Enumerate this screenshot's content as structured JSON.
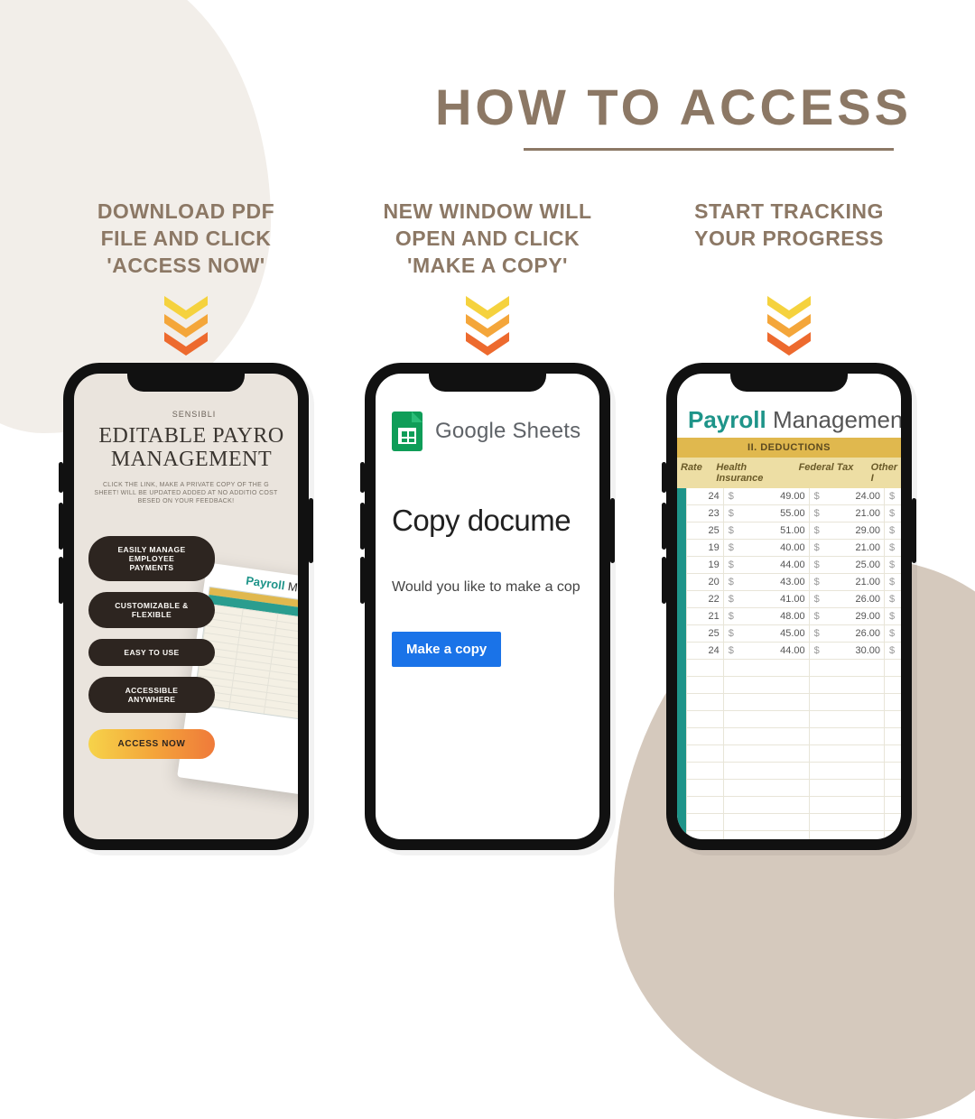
{
  "title": "HOW TO ACCESS",
  "columns": [
    {
      "caption": "DOWNLOAD PDF\nFILE AND CLICK\n'ACCESS NOW'"
    },
    {
      "caption": "NEW WINDOW WILL\nOPEN AND CLICK\n'MAKE A COPY'"
    },
    {
      "caption": "START TRACKING\nYOUR PROGRESS"
    }
  ],
  "phone1": {
    "brand": "SENSIBLI",
    "title": "EDITABLE PAYRO\nMANAGEMENT",
    "sub": "CLICK THE LINK, MAKE A PRIVATE COPY OF THE G\nSHEET! WILL BE UPDATED ADDED AT NO ADDITIO\nCOST BESED ON YOUR FEEDBACK!",
    "pills": [
      "EASILY MANAGE EMPLOYEE\nPAYMENTS",
      "CUSTOMIZABLE &\nFLEXIBLE",
      "EASY TO USE",
      "ACCESSIBLE\nANYWHERE"
    ],
    "cta": "ACCESS NOW",
    "cardTitle1": "Payroll",
    "cardTitle2": " Mana"
  },
  "phone2": {
    "appName": "Google Sheets",
    "heading": "Copy docume",
    "question": "Would you like to make a cop",
    "button": "Make a copy"
  },
  "phone3": {
    "title1": "Payroll",
    "title2": " Management",
    "band": "II.   DEDUCTIONS",
    "cols": {
      "rate": "Rate",
      "hi": "Health Insurance",
      "tax": "Federal Tax",
      "other": "Other I"
    },
    "rows": [
      {
        "rate": "24",
        "hi": "49.00",
        "tax": "24.00",
        "other": ""
      },
      {
        "rate": "23",
        "hi": "55.00",
        "tax": "21.00",
        "other": ""
      },
      {
        "rate": "25",
        "hi": "51.00",
        "tax": "29.00",
        "other": ""
      },
      {
        "rate": "19",
        "hi": "40.00",
        "tax": "21.00",
        "other": ""
      },
      {
        "rate": "19",
        "hi": "44.00",
        "tax": "25.00",
        "other": ""
      },
      {
        "rate": "20",
        "hi": "43.00",
        "tax": "21.00",
        "other": ""
      },
      {
        "rate": "22",
        "hi": "41.00",
        "tax": "26.00",
        "other": ""
      },
      {
        "rate": "21",
        "hi": "48.00",
        "tax": "29.00",
        "other": ""
      },
      {
        "rate": "25",
        "hi": "45.00",
        "tax": "26.00",
        "other": ""
      },
      {
        "rate": "24",
        "hi": "44.00",
        "tax": "30.00",
        "other": ""
      }
    ],
    "emptyRows": 14
  }
}
